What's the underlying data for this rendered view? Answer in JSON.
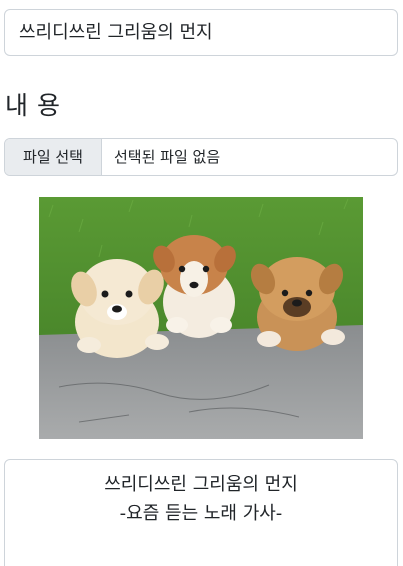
{
  "title_field": {
    "value": "쓰리디쓰린 그리움의 먼지"
  },
  "section": {
    "heading": "내 용"
  },
  "file_picker": {
    "button_label": "파일 선택",
    "status_text": "선택된 파일 없음"
  },
  "image": {
    "subject": "three puppies on grass"
  },
  "content": {
    "line1": "쓰리디쓰린 그리움의 먼지",
    "line2": "-요즘 듣는 노래 가사-"
  }
}
